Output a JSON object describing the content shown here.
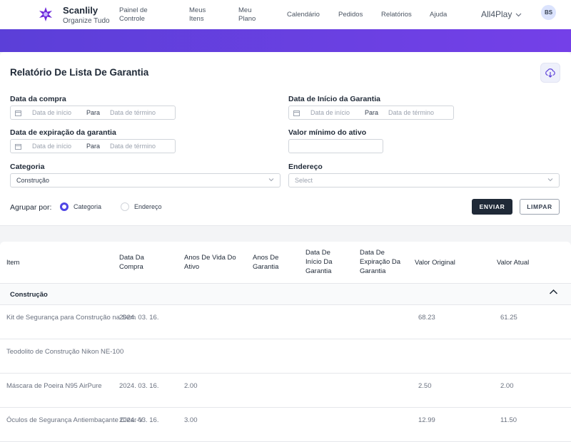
{
  "brand": {
    "name": "Scanlily",
    "tagline": "Organize Tudo"
  },
  "nav": {
    "items": [
      {
        "label": "Painel de\nControle"
      },
      {
        "label": "Meus\nItens"
      },
      {
        "label": "Meu\nPlano"
      },
      {
        "label": "Calendário"
      },
      {
        "label": "Pedidos"
      },
      {
        "label": "Relatórios"
      },
      {
        "label": "Ajuda"
      }
    ],
    "company": "All4Play",
    "avatar_initials": "BS"
  },
  "report": {
    "title": "Relatório De Lista De Garantia",
    "filters": {
      "purchase_date": {
        "label": "Data da compra",
        "start_placeholder": "Data de início",
        "separator": "Para",
        "end_placeholder": "Data de término"
      },
      "warranty_start": {
        "label": "Data de Início da Garantia",
        "start_placeholder": "Data de início",
        "separator": "Para",
        "end_placeholder": "Data de término"
      },
      "warranty_expiry": {
        "label": "Data de expiração da garantia",
        "start_placeholder": "Data de início",
        "separator": "Para",
        "end_placeholder": "Data de término"
      },
      "min_value": {
        "label": "Valor mínimo do ativo",
        "value": ""
      },
      "category": {
        "label": "Categoria",
        "value": "Construção"
      },
      "address": {
        "label": "Endereço",
        "placeholder": "Select"
      }
    },
    "group_by": {
      "label": "Agrupar por:",
      "options": [
        "Categoria",
        "Endereço"
      ],
      "selected": "Categoria"
    },
    "buttons": {
      "send": "ENVIAR",
      "clear": "LIMPAR"
    }
  },
  "table": {
    "columns": [
      "Item",
      "Data Da\nCompra",
      "Anos De Vida Do\nAtivo",
      "Anos De\nGarantia",
      "Data De\nInício Da\nGarantia",
      "Data De\nExpiração Da\nGarantia",
      "Valor Original",
      "Valor Atual"
    ],
    "groups": [
      {
        "name": "Construção",
        "rows": [
          {
            "item": "Kit de Segurança para Construção na Sem",
            "purchase_date": "2024. 03. 16.",
            "life_years": "",
            "warranty_years": "",
            "warranty_start": "",
            "warranty_expiry": "",
            "original_value": "68.23",
            "current_value": "61.25"
          },
          {
            "item": "Teodolito de Construção Nikon NE-100",
            "purchase_date": "",
            "life_years": "",
            "warranty_years": "",
            "warranty_start": "",
            "warranty_expiry": "",
            "original_value": "",
            "current_value": ""
          },
          {
            "item": "Máscara de Poeira N95 AirPure",
            "purchase_date": "2024. 03. 16.",
            "life_years": "2.00",
            "warranty_years": "",
            "warranty_start": "",
            "warranty_expiry": "",
            "original_value": "2.50",
            "current_value": "2.00"
          },
          {
            "item": "Óculos de Segurança Antiembaçante Clear-V",
            "purchase_date": "2024. 03. 16.",
            "life_years": "3.00",
            "warranty_years": "",
            "warranty_start": "",
            "warranty_expiry": "",
            "original_value": "12.99",
            "current_value": "11.50"
          }
        ]
      }
    ]
  },
  "colors": {
    "accent": "#4f46e5",
    "banner_start": "#5b3fd8",
    "banner_end": "#7440e8",
    "primary_button": "#1f2937"
  },
  "icons": [
    "logo-mark",
    "chevron-down-icon",
    "download-cloud-icon",
    "calendar-icon",
    "chevron-up-icon"
  ]
}
